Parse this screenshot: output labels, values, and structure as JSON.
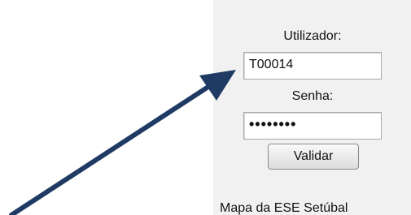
{
  "login": {
    "username_label": "Utilizador:",
    "username_value": "T00014",
    "password_label": "Senha:",
    "password_value": "••••••••",
    "submit_label": "Validar"
  },
  "footer": {
    "link_text": "Mapa da ESE Setúbal"
  },
  "annotation": {
    "arrow_color": "#1f3b64"
  }
}
